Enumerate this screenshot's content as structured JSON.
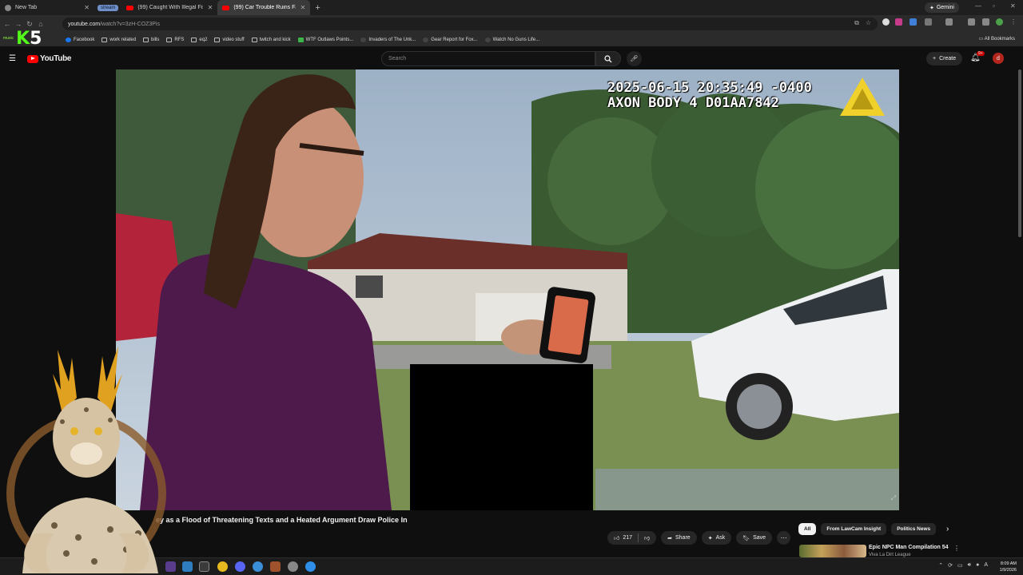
{
  "browser": {
    "tabs": [
      {
        "label": "New Tab",
        "active": false
      },
      {
        "label": "(99) Caught With Illegal Fish in...",
        "active": false
      },
      {
        "label": "(99) Car Trouble Ruins Fath...",
        "active": true
      }
    ],
    "tab_group_label": "stream",
    "new_tab_symbol": "+",
    "gemini_label": "Gemini",
    "url_host": "youtube.com",
    "url_path": "/watch?v=3zH-COZ3Pis",
    "bookmarks": [
      "Facebook",
      "work related",
      "bills",
      "RFS",
      "eq2",
      "video stuff",
      "twitch and kick",
      "WTF Outlaws Points...",
      "Invaders of The Unk...",
      "Gear Report for Fox...",
      "Watch No Guns Life..."
    ],
    "all_bookmarks_label": "All Bookmarks"
  },
  "stream_overlay": {
    "music_label": "music",
    "logo_k": "K",
    "logo_5": "5"
  },
  "youtube": {
    "logo_text": "YouTube",
    "search_placeholder": "Search",
    "create_label": "Create",
    "notif_badge": "9+",
    "avatar_letter": "d"
  },
  "video": {
    "timestamp_line1": "2025-06-15 20:35:49 -0400",
    "timestamp_line2": "AXON BODY 4 D01AA7842",
    "title": "ey as a Flood of Threatening Texts and a Heated Argument Draw Police In"
  },
  "actions": {
    "like_count": "217",
    "share_label": "Share",
    "ask_label": "Ask",
    "save_label": "Save"
  },
  "chips": [
    "All",
    "From LawCam Insight",
    "Politics News"
  ],
  "recommendation": {
    "title": "Epic NPC Man Compilation 54",
    "channel": "Viva La Dirt League"
  },
  "taskbar": {
    "time": "8:09 AM",
    "date": "1/9/2026"
  },
  "colors": {
    "yt_red": "#ff0000",
    "kick_green": "#53fc18",
    "page_bg": "#0f0f0f"
  }
}
